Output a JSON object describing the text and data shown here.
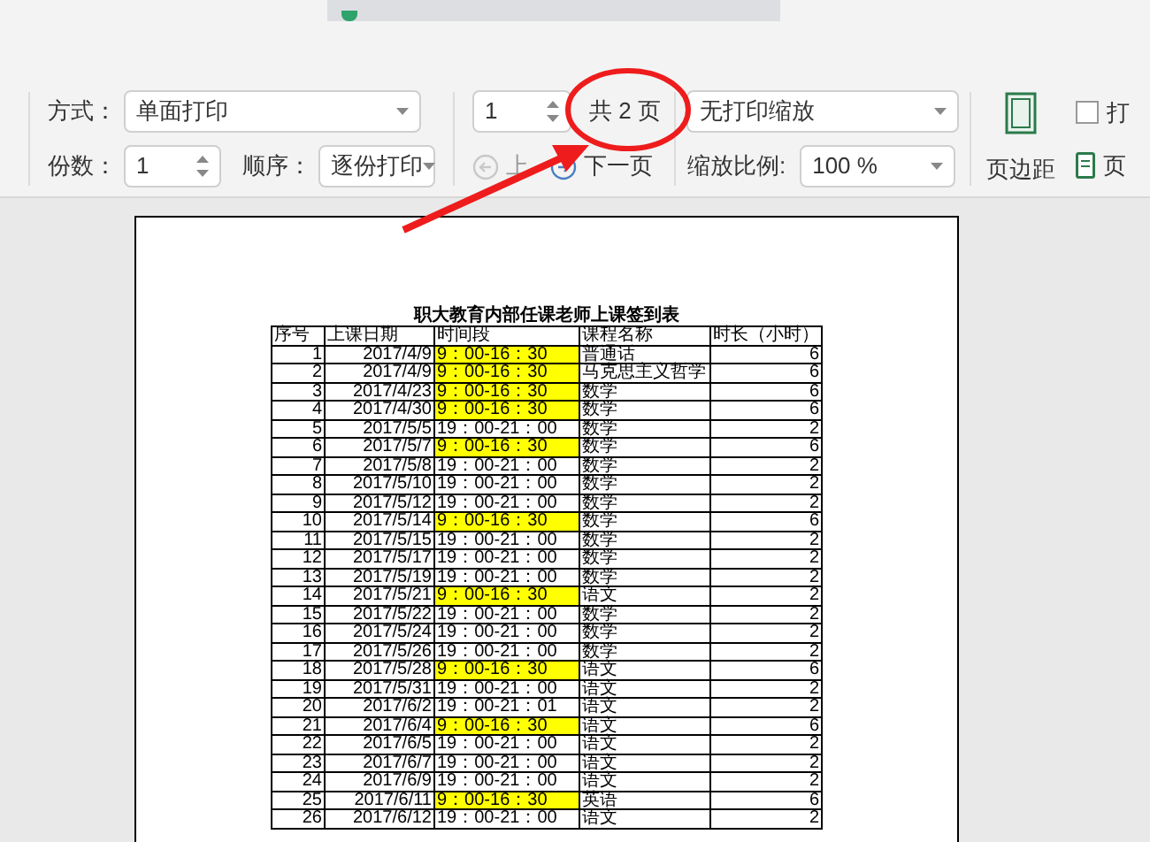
{
  "print_options": {
    "mode_label": "方式：",
    "mode": "单面打印",
    "copies_label": "份数：",
    "copies": "1",
    "order_label": "顺序：",
    "order": "逐份打印"
  },
  "pages": {
    "current": "1",
    "total": "共 2 页",
    "prev": {
      "label": "上",
      "disabled": true
    },
    "next": {
      "label": "下一页",
      "disabled": false
    }
  },
  "scaling": {
    "mode": "无打印缩放",
    "ratio_label": "缩放比例:",
    "ratio": "100 %"
  },
  "margins": {
    "label": "页边距"
  },
  "right_group": {
    "checkbox": {
      "label": "打",
      "checked": false
    },
    "item_label": "页"
  },
  "sheet": {
    "title": "职大教育内部任课老师上课签到表",
    "columns": [
      "序号",
      "上课日期",
      "时间段",
      "课程名称",
      "时长（小时）"
    ],
    "rows": [
      {
        "cells": [
          "1",
          "2017/4/9",
          "9：00-16：30",
          "普通话",
          "6"
        ],
        "highlight": true
      },
      {
        "cells": [
          "2",
          "2017/4/9",
          "9：00-16：30",
          "马克思主义哲学",
          "6"
        ],
        "highlight": true
      },
      {
        "cells": [
          "3",
          "2017/4/23",
          "9：00-16：30",
          "数学",
          "6"
        ],
        "highlight": true
      },
      {
        "cells": [
          "4",
          "2017/4/30",
          "9：00-16：30",
          "数学",
          "6"
        ],
        "highlight": true
      },
      {
        "cells": [
          "5",
          "2017/5/5",
          "19：00-21：00",
          "数学",
          "2"
        ],
        "highlight": false
      },
      {
        "cells": [
          "6",
          "2017/5/7",
          "9：00-16：30",
          "数学",
          "6"
        ],
        "highlight": true
      },
      {
        "cells": [
          "7",
          "2017/5/8",
          "19：00-21：00",
          "数学",
          "2"
        ],
        "highlight": false
      },
      {
        "cells": [
          "8",
          "2017/5/10",
          "19：00-21：00",
          "数学",
          "2"
        ],
        "highlight": false
      },
      {
        "cells": [
          "9",
          "2017/5/12",
          "19：00-21：00",
          "数学",
          "2"
        ],
        "highlight": false
      },
      {
        "cells": [
          "10",
          "2017/5/14",
          "9：00-16：30",
          "数学",
          "6"
        ],
        "highlight": true
      },
      {
        "cells": [
          "11",
          "2017/5/15",
          "19：00-21：00",
          "数学",
          "2"
        ],
        "highlight": false
      },
      {
        "cells": [
          "12",
          "2017/5/17",
          "19：00-21：00",
          "数学",
          "2"
        ],
        "highlight": false
      },
      {
        "cells": [
          "13",
          "2017/5/19",
          "19：00-21：00",
          "数学",
          "2"
        ],
        "highlight": false
      },
      {
        "cells": [
          "14",
          "2017/5/21",
          "9：00-16：30",
          "语文",
          "2"
        ],
        "highlight": true
      },
      {
        "cells": [
          "15",
          "2017/5/22",
          "19：00-21：00",
          "数学",
          "2"
        ],
        "highlight": false
      },
      {
        "cells": [
          "16",
          "2017/5/24",
          "19：00-21：00",
          "数学",
          "2"
        ],
        "highlight": false
      },
      {
        "cells": [
          "17",
          "2017/5/26",
          "19：00-21：00",
          "数学",
          "2"
        ],
        "highlight": false
      },
      {
        "cells": [
          "18",
          "2017/5/28",
          "9：00-16：30",
          "语文",
          "6"
        ],
        "highlight": true
      },
      {
        "cells": [
          "19",
          "2017/5/31",
          "19：00-21：00",
          "语文",
          "2"
        ],
        "highlight": false
      },
      {
        "cells": [
          "20",
          "2017/6/2",
          "19：00-21：01",
          "语文",
          "2"
        ],
        "highlight": false
      },
      {
        "cells": [
          "21",
          "2017/6/4",
          "9：00-16：30",
          "语文",
          "6"
        ],
        "highlight": true
      },
      {
        "cells": [
          "22",
          "2017/6/5",
          "19：00-21：00",
          "语文",
          "2"
        ],
        "highlight": false
      },
      {
        "cells": [
          "23",
          "2017/6/7",
          "19：00-21：00",
          "语文",
          "2"
        ],
        "highlight": false
      },
      {
        "cells": [
          "24",
          "2017/6/9",
          "19：00-21：00",
          "语文",
          "2"
        ],
        "highlight": false
      },
      {
        "cells": [
          "25",
          "2017/6/11",
          "9：00-16：30",
          "英语",
          "6"
        ],
        "highlight": true
      },
      {
        "cells": [
          "26",
          "2017/6/12",
          "19：00-21：00",
          "语文",
          "2"
        ],
        "highlight": false
      }
    ]
  }
}
